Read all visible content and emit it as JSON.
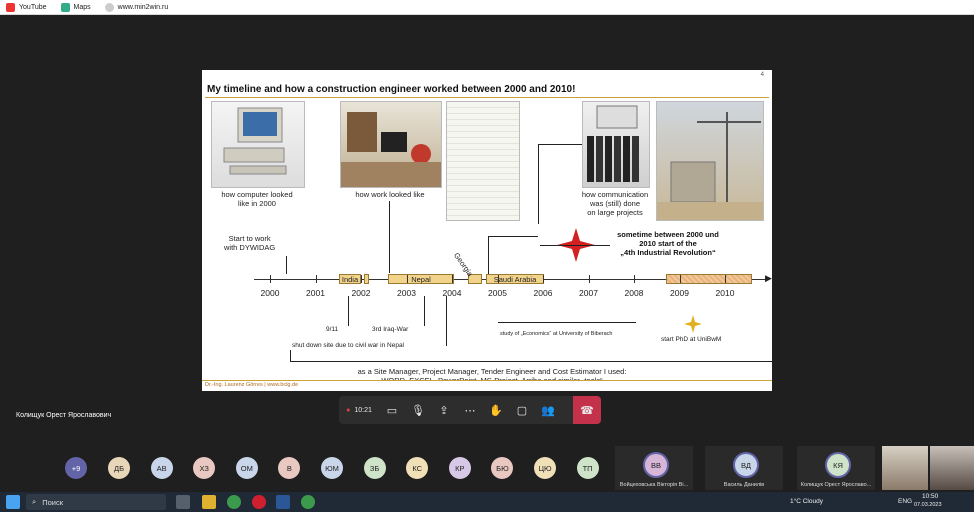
{
  "bookmarks": [
    {
      "label": "YouTube",
      "color": "#e33"
    },
    {
      "label": "Maps",
      "color": "#3a8"
    },
    {
      "label": "www.min2win.ru",
      "color": "#ddd"
    }
  ],
  "slide": {
    "number": "4",
    "title": "My timeline and how a construction engineer worked between 2000 and 2010!",
    "captions": {
      "computer": "how computer looked\nlike in 2000",
      "work": "how work looked like",
      "communication": "how communication\nwas (still) done\non large projects"
    },
    "start_note": "Start to work\nwith DYWIDAG",
    "years": [
      "2000",
      "2001",
      "2002",
      "2003",
      "2004",
      "2005",
      "2006",
      "2007",
      "2008",
      "2009",
      "2010"
    ],
    "bars": {
      "india": "India",
      "nepal": "Nepal",
      "georgia": "Georgia",
      "saudi": "Saudi Arabia"
    },
    "notes": {
      "nine_eleven": "9/11",
      "iraq": "3rd Iraq-War",
      "nepal_shutdown": "shut down site due to civil war in Nepal",
      "economics": "study of „Economics“ at University of Biberach",
      "phd": "start PhD at UniBwM",
      "industrial": "sometime between 2000 und\n2010 start of the\n„4th Industrial Revolution“",
      "tools": "as a Site Manager, Project Manager, Tender Engineer and Cost Estimator I used:\nWORD, EXCEL, PowerPoint, MS-Project, Arriba and similar „tools“"
    },
    "footer": "Dr.-Ing. Laurenz Görres | www.bclg.de"
  },
  "speaker": "Колищук Орест Ярославович",
  "controls": {
    "timer": "10:21"
  },
  "participants": {
    "more": "+9",
    "small": [
      {
        "initials": "ДБ",
        "color": "#e8d6b8"
      },
      {
        "initials": "АВ",
        "color": "#c9d6ea"
      },
      {
        "initials": "ХЗ",
        "color": "#e8c8c0"
      },
      {
        "initials": "ОМ",
        "color": "#c9d6ea"
      },
      {
        "initials": "В",
        "color": "#e8c8c0"
      },
      {
        "initials": "ЮМ",
        "color": "#c9d6ea"
      },
      {
        "initials": "ЗБ",
        "color": "#cfe3c8"
      },
      {
        "initials": "КС",
        "color": "#f0e0b8"
      },
      {
        "initials": "КР",
        "color": "#d8c8e8"
      },
      {
        "initials": "БЮ",
        "color": "#e8c8c0"
      },
      {
        "initials": "ЦЮ",
        "color": "#f0e0b8"
      },
      {
        "initials": "ТП",
        "color": "#cfe3c8"
      }
    ],
    "large": [
      {
        "initials": "ВВ",
        "name": "Войцеховська Вікторія Ві..."
      },
      {
        "initials": "ВД",
        "name": "Василь Данилів"
      },
      {
        "initials": "КЯ",
        "name": "Колищук Орест Ярославо..."
      }
    ]
  },
  "taskbar": {
    "search_placeholder": "Поиск",
    "weather": "1°C  Cloudy",
    "lang": "ENG",
    "time": "10:50",
    "date": "07.03.2023"
  }
}
